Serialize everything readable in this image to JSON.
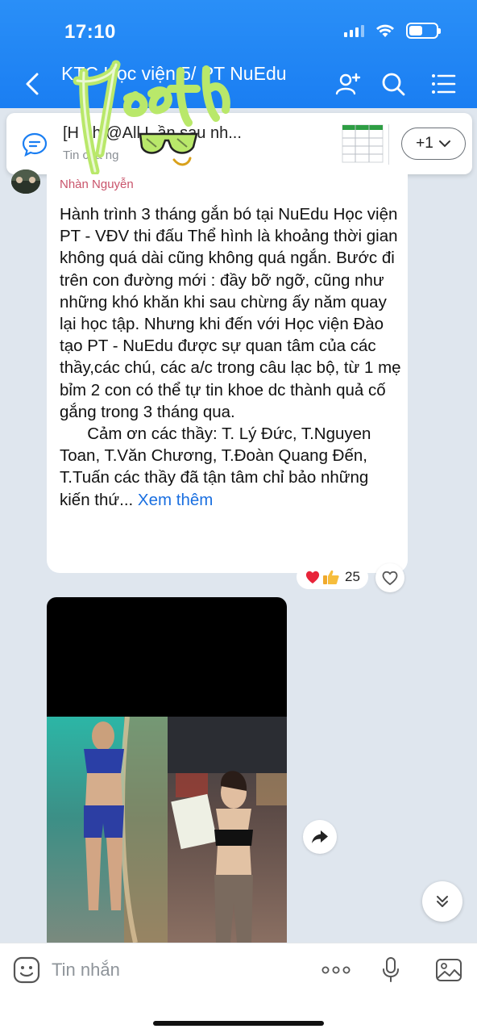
{
  "status_bar": {
    "time": "17:10"
  },
  "header": {
    "title": "KTC Học viện 5/ PT NuEdu"
  },
  "pinned": {
    "title": "[H  nh @All L   ần sau nh...",
    "subtitle": "Tin   của   ng",
    "more_label": "+1"
  },
  "message": {
    "sender": "Nhàn Nguyễn",
    "text": "Hành trình 3 tháng gắn bó tại NuEdu Học viện PT - VĐV thi đấu Thể hình là khoảng thời gian không quá dài cũng không quá ngắn. Bước đi trên con đường mới : đầy bỡ ngỡ, cũng như những khó khăn khi sau chừng ấy năm quay lại học tập. Nhưng khi đến với Học viện Đào tạo PT - NuEdu được sự quan tâm của các thầy,các chú, các a/c trong câu lạc bộ, từ 1 mẹ bỉm 2 con có thể tự tin khoe dc thành quả cố gắng trong 3 tháng qua.\n      Cảm ơn các thầy: T. Lý Đức, T.Nguyen Toan, T.Văn Chương, T.Đoàn Quang Đến, T.Tuấn các thầy đã tận tâm chỉ bảo những kiến thứ...",
    "see_more": " Xem thêm",
    "reaction_count": "25"
  },
  "input_bar": {
    "placeholder": "Tin nhắn"
  },
  "colors": {
    "header": "#1a7ef2",
    "sender": "#c9546b",
    "link": "#1a6fe0"
  },
  "icons": [
    "back-icon",
    "add-member-icon",
    "search-icon",
    "menu-icon",
    "chat-bubble-icon",
    "chevron-down-icon",
    "heart-icon",
    "thumbs-up-icon",
    "share-icon",
    "double-chevron-down-icon",
    "emoji-icon",
    "more-icon",
    "microphone-icon",
    "image-icon"
  ]
}
